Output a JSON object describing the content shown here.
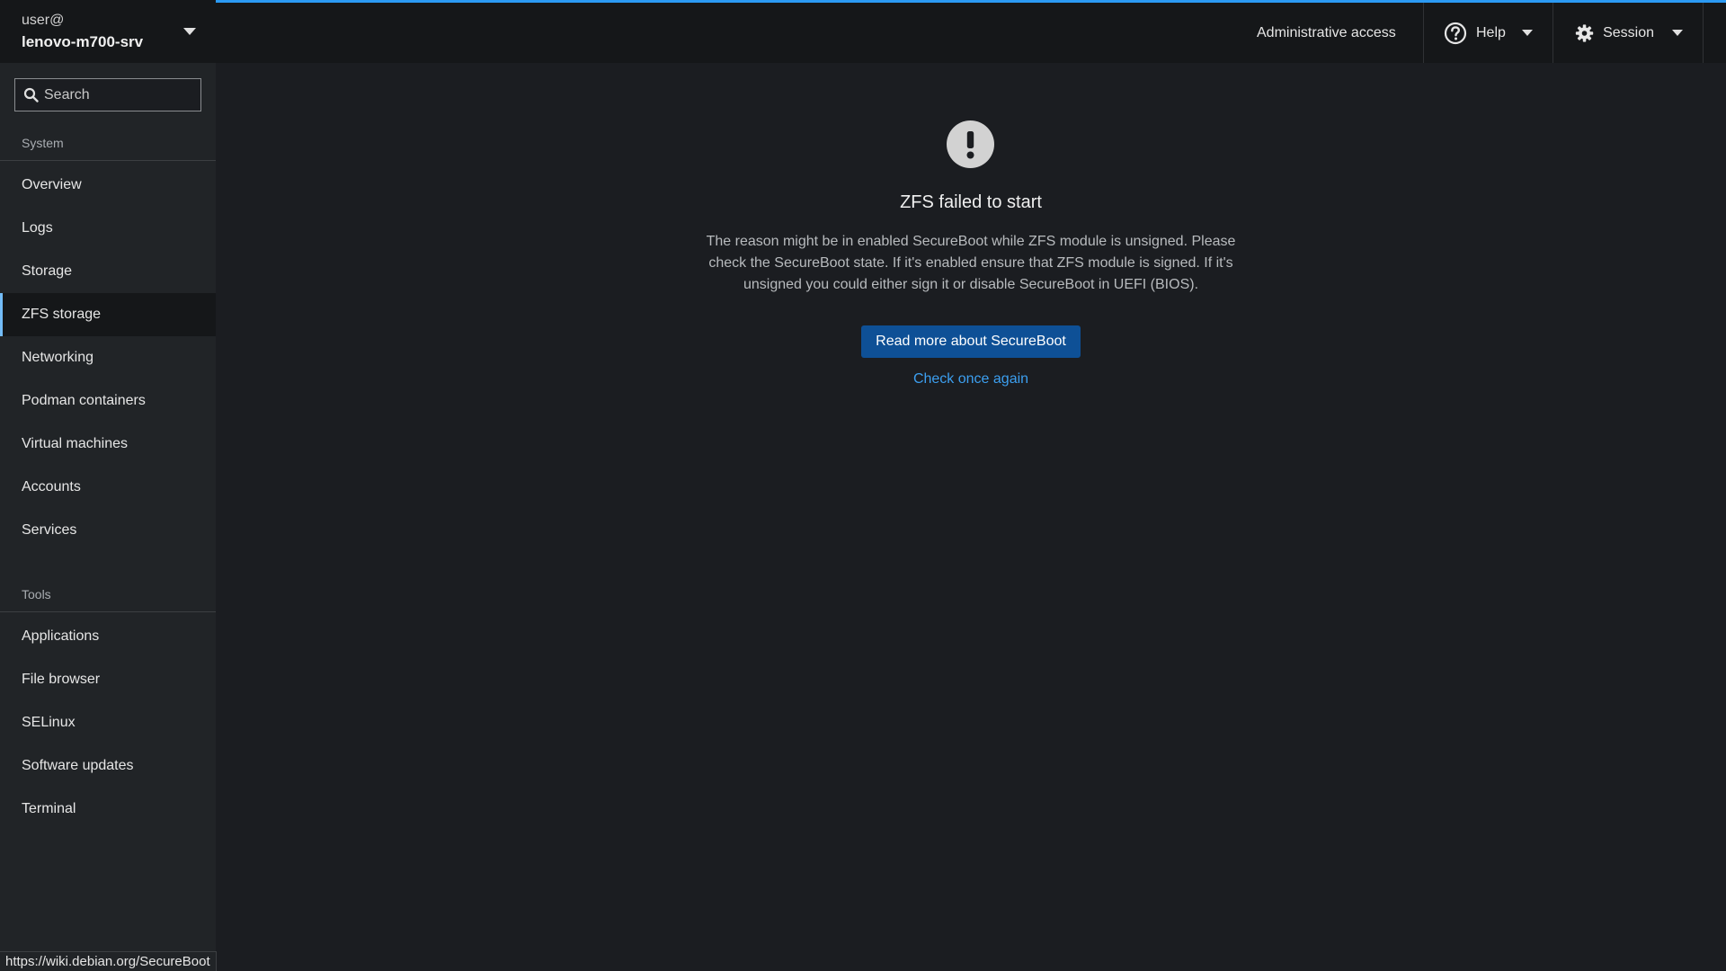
{
  "host": {
    "user": "user@",
    "name": "lenovo-m700-srv"
  },
  "search": {
    "placeholder": "Search"
  },
  "sidebar": {
    "system_label": "System",
    "system_items": [
      {
        "label": "Overview"
      },
      {
        "label": "Logs"
      },
      {
        "label": "Storage"
      },
      {
        "label": "ZFS storage"
      },
      {
        "label": "Networking"
      },
      {
        "label": "Podman containers"
      },
      {
        "label": "Virtual machines"
      },
      {
        "label": "Accounts"
      },
      {
        "label": "Services"
      }
    ],
    "active_item": "ZFS storage",
    "tools_label": "Tools",
    "tools_items": [
      {
        "label": "Applications"
      },
      {
        "label": "File browser"
      },
      {
        "label": "SELinux"
      },
      {
        "label": "Software updates"
      },
      {
        "label": "Terminal"
      }
    ]
  },
  "topbar": {
    "admin_access": "Administrative access",
    "help_label": "Help",
    "session_label": "Session",
    "help_icon": "question-circle-icon",
    "session_icon": "gear-icon"
  },
  "main": {
    "icon": "exclamation-circle-icon",
    "title": "ZFS failed to start",
    "body": "The reason might be in enabled SecureBoot while ZFS module is unsigned. Please check the SecureBoot state. If it's enabled ensure that ZFS module is signed. If it's unsigned you could either sign it or disable SecureBoot in UEFI (BIOS).",
    "primary_button": "Read more about SecureBoot",
    "link_button": "Check once again"
  },
  "statusbar": {
    "url": "https://wiki.debian.org/SecureBoot"
  },
  "colors": {
    "accent": "#73bcf7",
    "primary_button": "#0e5096",
    "link": "#3c9ff0",
    "progress": "#2b9af3"
  }
}
